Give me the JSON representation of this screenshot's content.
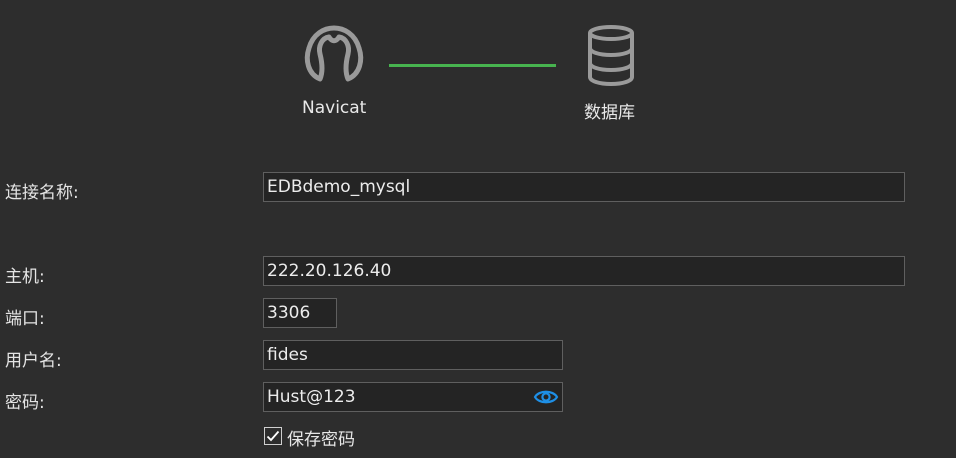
{
  "header": {
    "left_label": "Navicat",
    "right_label": "数据库",
    "left_icon": "navicat-logo-icon",
    "right_icon": "database-icon",
    "connector_color": "#47b34f"
  },
  "form": {
    "connection_name": {
      "label": "连接名称:",
      "value": "EDBdemo_mysql"
    },
    "host": {
      "label": "主机:",
      "value": "222.20.126.40"
    },
    "port": {
      "label": "端口:",
      "value": "3306"
    },
    "username": {
      "label": "用户名:",
      "value": "fides"
    },
    "password": {
      "label": "密码:",
      "value": "Hust@123",
      "reveal_icon": "eye-icon"
    },
    "save_password": {
      "label": "保存密码",
      "checked": true
    }
  },
  "colors": {
    "background": "#2d2d2d",
    "field_background": "#242424",
    "field_border": "#5f5f5f",
    "accent_blue": "#1e8fe6"
  }
}
